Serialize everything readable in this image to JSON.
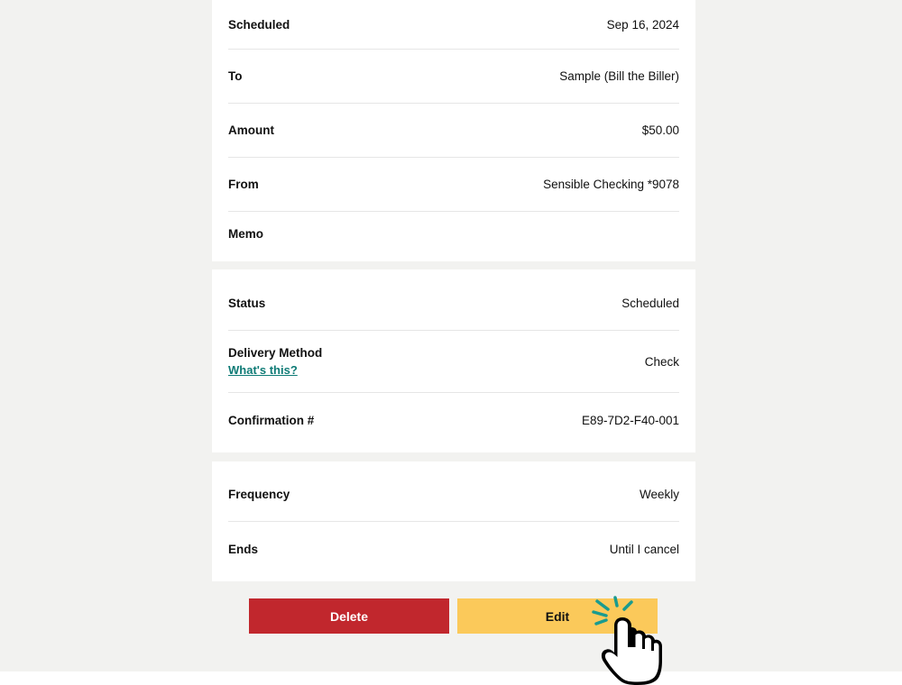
{
  "details": {
    "scheduled_label": "Scheduled",
    "scheduled_value": "Sep 16, 2024",
    "to_label": "To",
    "to_value": "Sample (Bill the Biller)",
    "amount_label": "Amount",
    "amount_value": "$50.00",
    "from_label": "From",
    "from_value": "Sensible Checking *9078",
    "memo_label": "Memo"
  },
  "status_card": {
    "status_label": "Status",
    "status_value": "Scheduled",
    "delivery_label": "Delivery Method",
    "delivery_help_link": "What's this?",
    "delivery_value": "Check",
    "confirmation_label": "Confirmation #",
    "confirmation_value": "E89-7D2-F40-001"
  },
  "recurrence": {
    "frequency_label": "Frequency",
    "frequency_value": "Weekly",
    "ends_label": "Ends",
    "ends_value": "Until I cancel"
  },
  "actions": {
    "delete_label": "Delete",
    "edit_label": "Edit"
  },
  "colors": {
    "page_background": "#f2f2f0",
    "delete_button": "#c1272d",
    "edit_button": "#fbc95a",
    "link": "#0f7b76",
    "click_burst": "#1a9b8f"
  },
  "icons": {
    "cursor": "pointer-hand-icon"
  }
}
